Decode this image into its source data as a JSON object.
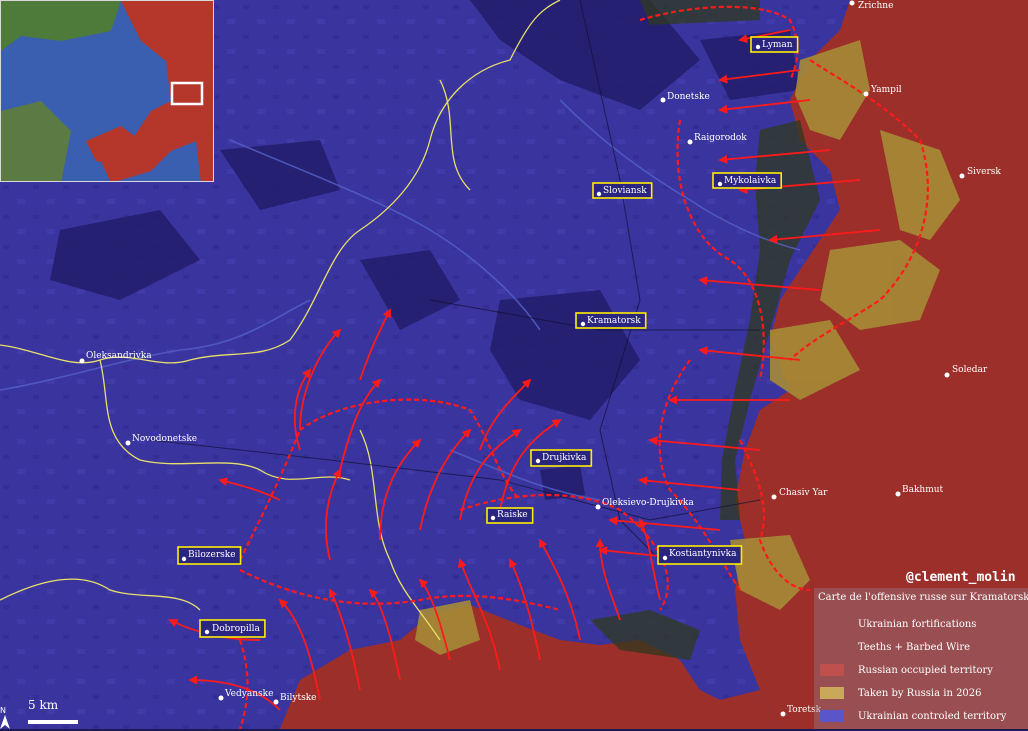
{
  "map": {
    "credit": "@clement_molin",
    "scale_label": "5 km",
    "north_label": "N",
    "colors": {
      "ukrainian": "#3d36a8",
      "russian": "#b5362b",
      "taken_2026": "#b59a38",
      "arrow": "#ff1a1a",
      "box": "#ffee00"
    }
  },
  "cities_boxed": [
    {
      "name": "Lyman"
    },
    {
      "name": "Mykolaivka"
    },
    {
      "name": "Sloviansk"
    },
    {
      "name": "Kramatorsk"
    },
    {
      "name": "Drujkivka"
    },
    {
      "name": "Raiske"
    },
    {
      "name": "Kostiantynivka"
    },
    {
      "name": "Bilozerske"
    },
    {
      "name": "Dobropilla"
    }
  ],
  "cities_plain": [
    {
      "name": "Zrichne"
    },
    {
      "name": "Yampil"
    },
    {
      "name": "Donetske"
    },
    {
      "name": "Raigorodok"
    },
    {
      "name": "Siversk"
    },
    {
      "name": "Soledar"
    },
    {
      "name": "Bakhmut"
    },
    {
      "name": "Chasiv Yar"
    },
    {
      "name": "Oleksievo-Drujkivka"
    },
    {
      "name": "Oleksandrivka"
    },
    {
      "name": "Novodonetske"
    },
    {
      "name": "Vedyanske"
    },
    {
      "name": "Bilytske"
    },
    {
      "name": "Toretsk"
    }
  ],
  "legend": {
    "title": "Carte de l'offensive russe sur Kramatorsk",
    "items": [
      {
        "label": "Ukrainian fortifications"
      },
      {
        "label": "Teeths + Barbed Wire"
      },
      {
        "label": "Russian occupied territory",
        "color": "#c0504d"
      },
      {
        "label": "Taken by Russia in 2026",
        "color": "#c9a85a"
      },
      {
        "label": "Ukrainian controled territory",
        "color": "#5a55c8"
      }
    ]
  }
}
